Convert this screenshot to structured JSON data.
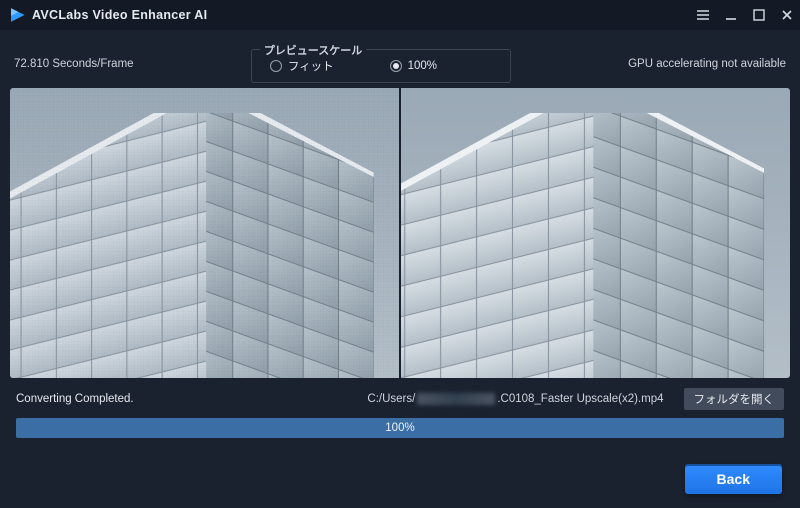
{
  "title": "AVCLabs Video Enhancer AI",
  "top": {
    "seconds_per_frame": "72.810 Seconds/Frame",
    "gpu": "GPU accelerating not available"
  },
  "preview_scale": {
    "label": "プレビュースケール",
    "fit": "フィット",
    "hundred": "100%",
    "selected": "100%"
  },
  "status": {
    "text": "Converting Completed.",
    "path_prefix": "C:/Users/",
    "path_suffix": ".C0108_Faster Upscale(x2).mp4",
    "open_folder": "フォルダを開く"
  },
  "progress": {
    "percent": 100,
    "label": "100%"
  },
  "back_button": "Back",
  "icons": {
    "menu": "menu-icon",
    "minimize": "minimize-icon",
    "maximize": "maximize-icon",
    "close": "close-icon"
  }
}
